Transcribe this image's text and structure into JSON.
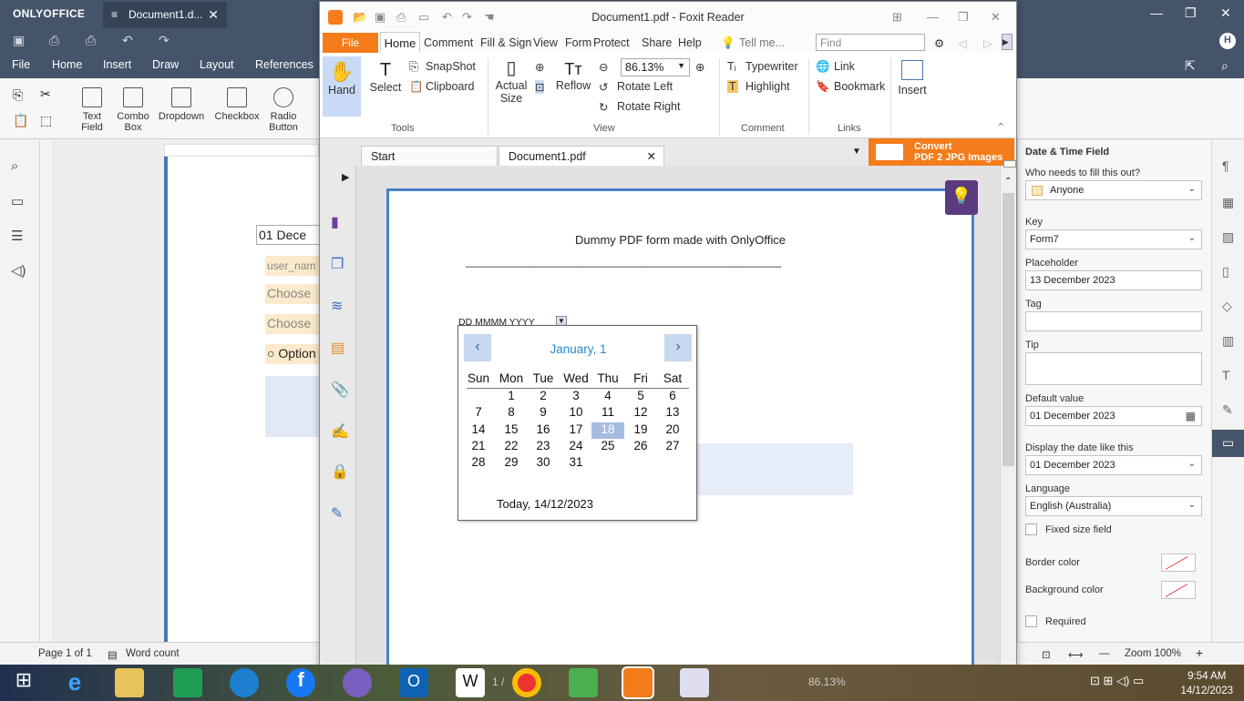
{
  "oo": {
    "app_name": "ONLYOFFICE",
    "tab_title": "Document1.d...",
    "menu": [
      "File",
      "Home",
      "Insert",
      "Draw",
      "Layout",
      "References"
    ],
    "ribbon": [
      {
        "label": "Text\nField",
        "icon": "text-field-icon"
      },
      {
        "label": "Combo\nBox",
        "icon": "combo-box-icon"
      },
      {
        "label": "Dropdown",
        "icon": "dropdown-icon"
      },
      {
        "label": "Checkbox",
        "icon": "checkbox-icon"
      },
      {
        "label": "Radio\nButton",
        "icon": "radio-button-icon"
      }
    ],
    "text_field_label": "Text",
    "text_field_label2": "Field",
    "combo_label": "Combo",
    "combo_label2": "Box",
    "dropdown_label": "Dropdown",
    "checkbox_label": "Checkbox",
    "radio_label": "Radio",
    "radio_label2": "Button",
    "form_fields": {
      "date": "01 Dece",
      "user": "user_nam",
      "choose1": "Choose",
      "choose2": "Choose",
      "option": "Option"
    },
    "status": {
      "page": "Page 1 of 1",
      "word_count": "Word count",
      "zoom": "Zoom 100%"
    },
    "right_panel": {
      "section_title": "Date & Time Field",
      "who_label": "Who needs to fill this out?",
      "who_value": "Anyone",
      "key_label": "Key",
      "key_value": "Form7",
      "placeholder_label": "Placeholder",
      "placeholder_value": "13 December 2023",
      "tag_label": "Tag",
      "tag_value": "",
      "tip_label": "Tip",
      "tip_value": "",
      "default_label": "Default value",
      "default_value": "01 December 2023",
      "display_label": "Display the date like this",
      "display_value": "01 December 2023",
      "language_label": "Language",
      "language_value": "English (Australia)",
      "fixed_size_label": "Fixed size field",
      "border_color_label": "Border color",
      "background_color_label": "Background color",
      "required_label": "Required"
    }
  },
  "fx": {
    "title": "Document1.pdf - Foxit Reader",
    "menu": {
      "file": "File",
      "home": "Home",
      "comment": "Comment",
      "fill_sign": "Fill & Sign",
      "view": "View",
      "form": "Form",
      "protect": "Protect",
      "share": "Share",
      "help": "Help",
      "tell_me": "Tell me..."
    },
    "find_placeholder": "Find",
    "ribbon": {
      "hand": "Hand",
      "select": "Select",
      "snapshot": "SnapShot",
      "clipboard": "Clipboard",
      "actual_size": "Actual\nSize",
      "actual1": "Actual",
      "actual2": "Size",
      "reflow": "Reflow",
      "zoom": "86.13%",
      "rotate_left": "Rotate Left",
      "rotate_right": "Rotate Right",
      "typewriter": "Typewriter",
      "highlight": "Highlight",
      "link": "Link",
      "bookmark": "Bookmark",
      "insert": "Insert",
      "group_tools": "Tools",
      "group_view": "View",
      "group_comment": "Comment",
      "group_links": "Links"
    },
    "tabs": {
      "start": "Start",
      "doc": "Document1.pdf"
    },
    "convert": {
      "line1": "Convert",
      "line2": "PDF 2 JPG Images"
    },
    "page": {
      "heading": "Dummy PDF form made with OnlyOffice",
      "rule": "________________________________________________________",
      "date_format": "DD MMMM YYYY"
    },
    "calendar": {
      "month": "January, 1",
      "dow": [
        "Sun",
        "Mon",
        "Tue",
        "Wed",
        "Thu",
        "Fri",
        "Sat"
      ],
      "weeks": [
        [
          "",
          "1",
          "2",
          "3",
          "4",
          "5",
          "6"
        ],
        [
          "7",
          "8",
          "9",
          "10",
          "11",
          "12",
          "13"
        ],
        [
          "14",
          "15",
          "16",
          "17",
          "18",
          "19",
          "20"
        ],
        [
          "21",
          "22",
          "23",
          "24",
          "25",
          "26",
          "27"
        ],
        [
          "28",
          "29",
          "30",
          "31",
          "",
          "",
          ""
        ]
      ],
      "selected": "18",
      "today": "Today, 14/12/2023"
    },
    "page_nav": "1 /",
    "zoom_bottom": "86.13%"
  },
  "taskbar": {
    "time": "9:54 AM",
    "date": "14/12/2023"
  }
}
